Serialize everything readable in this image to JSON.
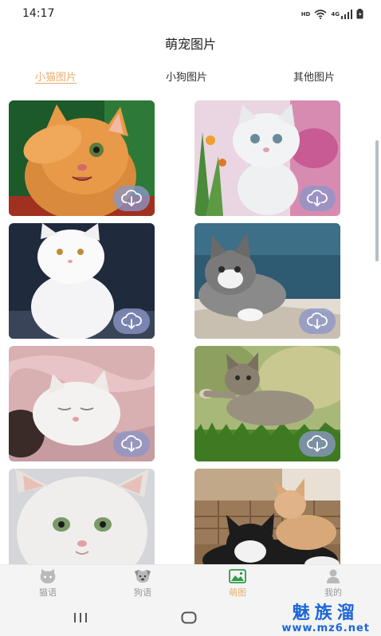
{
  "status_bar": {
    "time": "14:17",
    "hd_label": "HD",
    "network_label": "4G"
  },
  "header": {
    "title": "萌宠图片"
  },
  "tabs": [
    {
      "label": "小猫图片",
      "active": true
    },
    {
      "label": "小狗图片",
      "active": false
    },
    {
      "label": "其他图片",
      "active": false
    }
  ],
  "photos": [
    {
      "subject": "orange tabby kitten covering eye"
    },
    {
      "subject": "white kitten sitting among flowers"
    },
    {
      "subject": "white persian kitten sitting"
    },
    {
      "subject": "tabby kitten lying on cushion"
    },
    {
      "subject": "white kitten sleeping on pink blanket"
    },
    {
      "subject": "tabby kitten playing on grass"
    },
    {
      "subject": "fluffy white kitten"
    },
    {
      "subject": "black and white cat with orange kitten"
    }
  ],
  "bottom_nav": [
    {
      "label": "猫语",
      "icon": "cat-face-icon",
      "active": false
    },
    {
      "label": "狗语",
      "icon": "dog-face-icon",
      "active": false
    },
    {
      "label": "萌图",
      "icon": "image-icon",
      "active": true
    },
    {
      "label": "我的",
      "icon": "person-icon",
      "active": false
    }
  ],
  "watermark": {
    "top": "魅族溜",
    "bottom": "www.mz6.net"
  },
  "colors": {
    "accent": "#e7b070",
    "download_pill": "#8c96c8"
  }
}
